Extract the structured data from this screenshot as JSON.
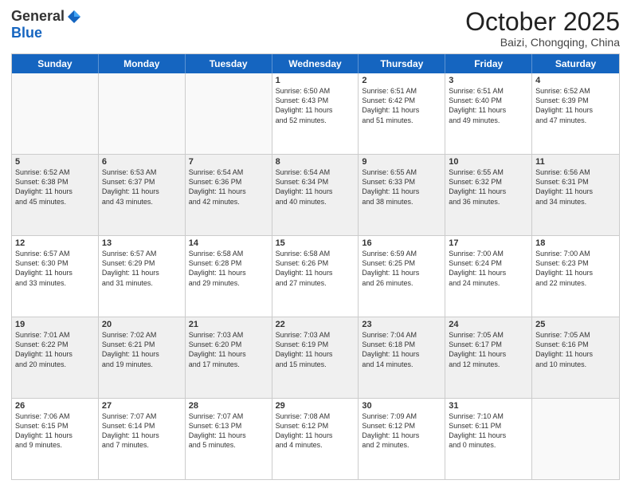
{
  "logo": {
    "general": "General",
    "blue": "Blue"
  },
  "title": "October 2025",
  "location": "Baizi, Chongqing, China",
  "weekdays": [
    "Sunday",
    "Monday",
    "Tuesday",
    "Wednesday",
    "Thursday",
    "Friday",
    "Saturday"
  ],
  "rows": [
    [
      {
        "day": "",
        "info": "",
        "empty": true
      },
      {
        "day": "",
        "info": "",
        "empty": true
      },
      {
        "day": "",
        "info": "",
        "empty": true
      },
      {
        "day": "1",
        "info": "Sunrise: 6:50 AM\nSunset: 6:43 PM\nDaylight: 11 hours\nand 52 minutes.",
        "shaded": false
      },
      {
        "day": "2",
        "info": "Sunrise: 6:51 AM\nSunset: 6:42 PM\nDaylight: 11 hours\nand 51 minutes.",
        "shaded": false
      },
      {
        "day": "3",
        "info": "Sunrise: 6:51 AM\nSunset: 6:40 PM\nDaylight: 11 hours\nand 49 minutes.",
        "shaded": false
      },
      {
        "day": "4",
        "info": "Sunrise: 6:52 AM\nSunset: 6:39 PM\nDaylight: 11 hours\nand 47 minutes.",
        "shaded": false
      }
    ],
    [
      {
        "day": "5",
        "info": "Sunrise: 6:52 AM\nSunset: 6:38 PM\nDaylight: 11 hours\nand 45 minutes.",
        "shaded": true
      },
      {
        "day": "6",
        "info": "Sunrise: 6:53 AM\nSunset: 6:37 PM\nDaylight: 11 hours\nand 43 minutes.",
        "shaded": true
      },
      {
        "day": "7",
        "info": "Sunrise: 6:54 AM\nSunset: 6:36 PM\nDaylight: 11 hours\nand 42 minutes.",
        "shaded": true
      },
      {
        "day": "8",
        "info": "Sunrise: 6:54 AM\nSunset: 6:34 PM\nDaylight: 11 hours\nand 40 minutes.",
        "shaded": true
      },
      {
        "day": "9",
        "info": "Sunrise: 6:55 AM\nSunset: 6:33 PM\nDaylight: 11 hours\nand 38 minutes.",
        "shaded": true
      },
      {
        "day": "10",
        "info": "Sunrise: 6:55 AM\nSunset: 6:32 PM\nDaylight: 11 hours\nand 36 minutes.",
        "shaded": true
      },
      {
        "day": "11",
        "info": "Sunrise: 6:56 AM\nSunset: 6:31 PM\nDaylight: 11 hours\nand 34 minutes.",
        "shaded": true
      }
    ],
    [
      {
        "day": "12",
        "info": "Sunrise: 6:57 AM\nSunset: 6:30 PM\nDaylight: 11 hours\nand 33 minutes.",
        "shaded": false
      },
      {
        "day": "13",
        "info": "Sunrise: 6:57 AM\nSunset: 6:29 PM\nDaylight: 11 hours\nand 31 minutes.",
        "shaded": false
      },
      {
        "day": "14",
        "info": "Sunrise: 6:58 AM\nSunset: 6:28 PM\nDaylight: 11 hours\nand 29 minutes.",
        "shaded": false
      },
      {
        "day": "15",
        "info": "Sunrise: 6:58 AM\nSunset: 6:26 PM\nDaylight: 11 hours\nand 27 minutes.",
        "shaded": false
      },
      {
        "day": "16",
        "info": "Sunrise: 6:59 AM\nSunset: 6:25 PM\nDaylight: 11 hours\nand 26 minutes.",
        "shaded": false
      },
      {
        "day": "17",
        "info": "Sunrise: 7:00 AM\nSunset: 6:24 PM\nDaylight: 11 hours\nand 24 minutes.",
        "shaded": false
      },
      {
        "day": "18",
        "info": "Sunrise: 7:00 AM\nSunset: 6:23 PM\nDaylight: 11 hours\nand 22 minutes.",
        "shaded": false
      }
    ],
    [
      {
        "day": "19",
        "info": "Sunrise: 7:01 AM\nSunset: 6:22 PM\nDaylight: 11 hours\nand 20 minutes.",
        "shaded": true
      },
      {
        "day": "20",
        "info": "Sunrise: 7:02 AM\nSunset: 6:21 PM\nDaylight: 11 hours\nand 19 minutes.",
        "shaded": true
      },
      {
        "day": "21",
        "info": "Sunrise: 7:03 AM\nSunset: 6:20 PM\nDaylight: 11 hours\nand 17 minutes.",
        "shaded": true
      },
      {
        "day": "22",
        "info": "Sunrise: 7:03 AM\nSunset: 6:19 PM\nDaylight: 11 hours\nand 15 minutes.",
        "shaded": true
      },
      {
        "day": "23",
        "info": "Sunrise: 7:04 AM\nSunset: 6:18 PM\nDaylight: 11 hours\nand 14 minutes.",
        "shaded": true
      },
      {
        "day": "24",
        "info": "Sunrise: 7:05 AM\nSunset: 6:17 PM\nDaylight: 11 hours\nand 12 minutes.",
        "shaded": true
      },
      {
        "day": "25",
        "info": "Sunrise: 7:05 AM\nSunset: 6:16 PM\nDaylight: 11 hours\nand 10 minutes.",
        "shaded": true
      }
    ],
    [
      {
        "day": "26",
        "info": "Sunrise: 7:06 AM\nSunset: 6:15 PM\nDaylight: 11 hours\nand 9 minutes.",
        "shaded": false
      },
      {
        "day": "27",
        "info": "Sunrise: 7:07 AM\nSunset: 6:14 PM\nDaylight: 11 hours\nand 7 minutes.",
        "shaded": false
      },
      {
        "day": "28",
        "info": "Sunrise: 7:07 AM\nSunset: 6:13 PM\nDaylight: 11 hours\nand 5 minutes.",
        "shaded": false
      },
      {
        "day": "29",
        "info": "Sunrise: 7:08 AM\nSunset: 6:12 PM\nDaylight: 11 hours\nand 4 minutes.",
        "shaded": false
      },
      {
        "day": "30",
        "info": "Sunrise: 7:09 AM\nSunset: 6:12 PM\nDaylight: 11 hours\nand 2 minutes.",
        "shaded": false
      },
      {
        "day": "31",
        "info": "Sunrise: 7:10 AM\nSunset: 6:11 PM\nDaylight: 11 hours\nand 0 minutes.",
        "shaded": false
      },
      {
        "day": "",
        "info": "",
        "empty": true
      }
    ]
  ]
}
